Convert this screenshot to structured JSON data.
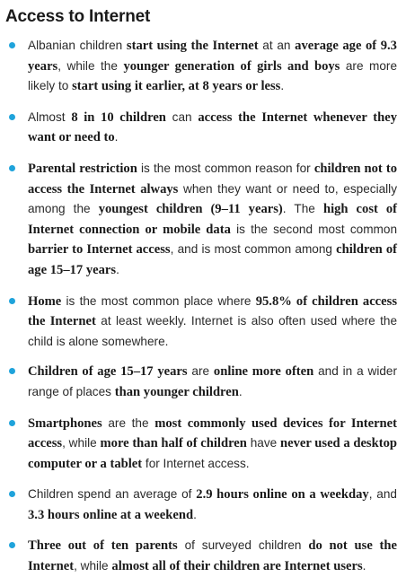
{
  "title": "Access to Internet",
  "accent_color": "#1fa3db",
  "bullets": [
    [
      {
        "t": "Albanian children ",
        "b": false
      },
      {
        "t": "start using the Internet",
        "b": true
      },
      {
        "t": " at an ",
        "b": false
      },
      {
        "t": "average age of 9.3 years",
        "b": true
      },
      {
        "t": ", while the ",
        "b": false
      },
      {
        "t": "younger generation of girls and boys",
        "b": true
      },
      {
        "t": " are more likely to ",
        "b": false
      },
      {
        "t": "start using it earlier, at 8 years or less",
        "b": true
      },
      {
        "t": ".",
        "b": false
      }
    ],
    [
      {
        "t": "Almost ",
        "b": false
      },
      {
        "t": "8 in 10 children",
        "b": true
      },
      {
        "t": " can ",
        "b": false
      },
      {
        "t": "access the Internet whenever they want or need to",
        "b": true
      },
      {
        "t": ".",
        "b": false
      }
    ],
    [
      {
        "t": "Parental restriction",
        "b": true
      },
      {
        "t": " is the most common reason for ",
        "b": false
      },
      {
        "t": "children not to access the Internet always",
        "b": true
      },
      {
        "t": " when they want or need to, especially among the ",
        "b": false
      },
      {
        "t": "youngest children (9–11 years)",
        "b": true
      },
      {
        "t": ". The ",
        "b": false
      },
      {
        "t": "high cost of Internet connection or mobile data",
        "b": true
      },
      {
        "t": " is the second most common ",
        "b": false
      },
      {
        "t": "barrier to Internet access",
        "b": true
      },
      {
        "t": ", and is most common among ",
        "b": false
      },
      {
        "t": "children of age 15–17 years",
        "b": true
      },
      {
        "t": ".",
        "b": false
      }
    ],
    [
      {
        "t": "Home",
        "b": true
      },
      {
        "t": " is the most common place where ",
        "b": false
      },
      {
        "t": "95.8% of children access the Internet",
        "b": true
      },
      {
        "t": " at least weekly. Internet is also often used where the child is alone somewhere.",
        "b": false
      }
    ],
    [
      {
        "t": "Children of age 15–17 years",
        "b": true
      },
      {
        "t": " are ",
        "b": false
      },
      {
        "t": "online more often",
        "b": true
      },
      {
        "t": " and in a wider range of places ",
        "b": false
      },
      {
        "t": "than younger children",
        "b": true
      },
      {
        "t": ".",
        "b": false
      }
    ],
    [
      {
        "t": "Smartphones",
        "b": true
      },
      {
        "t": " are the ",
        "b": false
      },
      {
        "t": "most commonly used devices for Internet access",
        "b": true
      },
      {
        "t": ", while ",
        "b": false
      },
      {
        "t": "more than half of children",
        "b": true
      },
      {
        "t": " have ",
        "b": false
      },
      {
        "t": "never used a desktop computer or a tablet",
        "b": true
      },
      {
        "t": " for Internet access.",
        "b": false
      }
    ],
    [
      {
        "t": "Children spend an average of ",
        "b": false
      },
      {
        "t": "2.9 hours online on a weekday",
        "b": true
      },
      {
        "t": ", and ",
        "b": false
      },
      {
        "t": "3.3 hours online at a weekend",
        "b": true
      },
      {
        "t": ".",
        "b": false
      }
    ],
    [
      {
        "t": "Three out of ten parents",
        "b": true
      },
      {
        "t": " of surveyed children ",
        "b": false
      },
      {
        "t": "do not use the Internet",
        "b": true
      },
      {
        "t": ", while ",
        "b": false
      },
      {
        "t": "almost all of their children are Internet users",
        "b": true
      },
      {
        "t": ".",
        "b": false
      }
    ]
  ]
}
